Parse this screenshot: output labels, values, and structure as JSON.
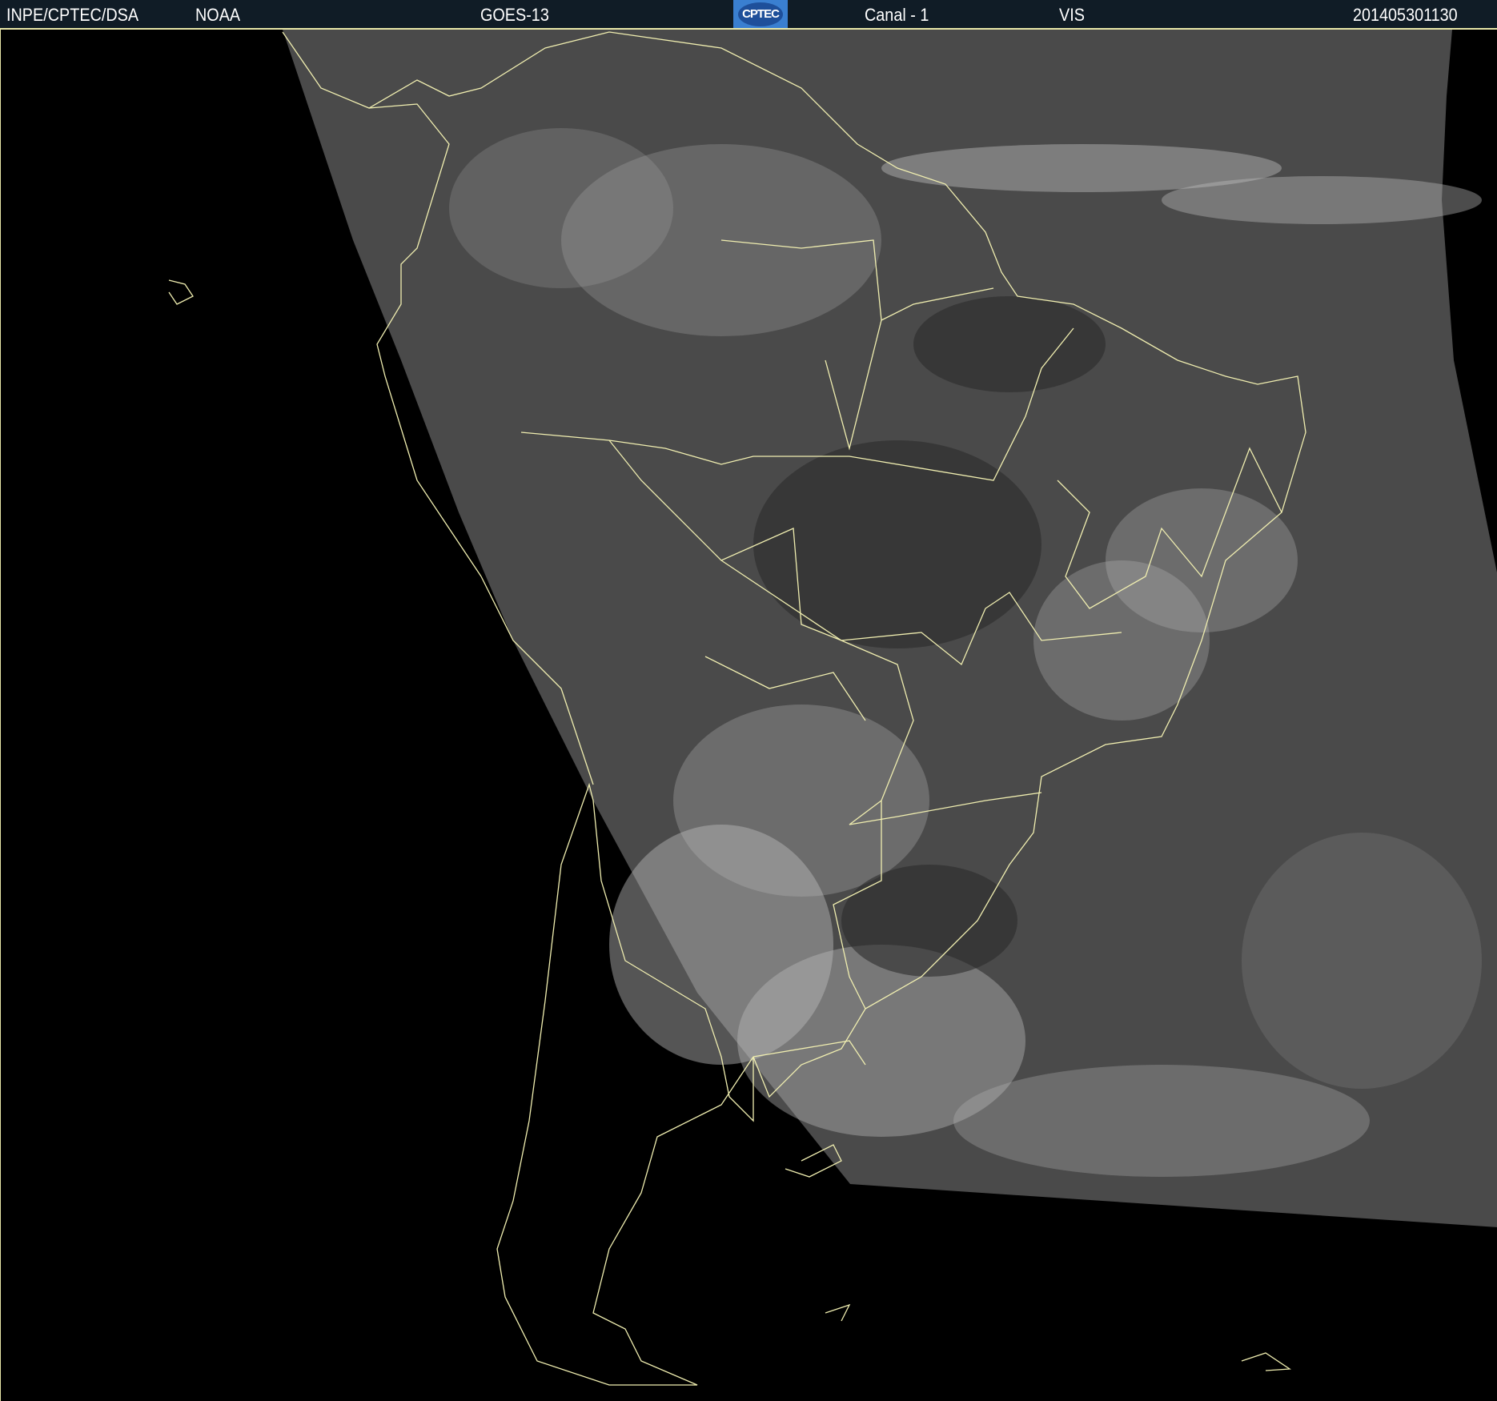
{
  "header": {
    "source": "INPE/CPTEC/DSA",
    "agency": "NOAA",
    "satellite": "GOES-13",
    "logo_text": "CPTEC",
    "channel": "Canal - 1",
    "band": "VIS",
    "timestamp": "201405301130"
  },
  "colors": {
    "header_bg": "#101c26",
    "border": "#e8e6a8",
    "land_outline": "#f0eeb0",
    "imagery_base": "#4a4a4a"
  }
}
